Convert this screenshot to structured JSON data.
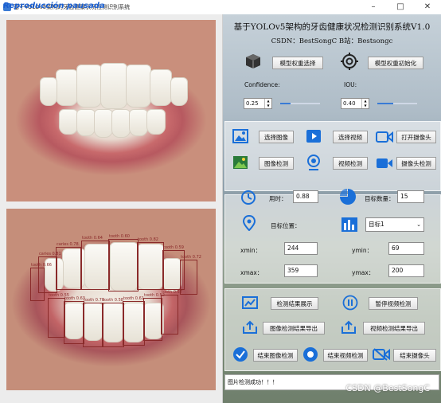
{
  "window": {
    "title": "基于YOLOv5架构的牙齿健康状况检测识别系统",
    "overlay_text": "Reproducción pausada",
    "controls": [
      "–",
      "□",
      "✕"
    ]
  },
  "header": {
    "title": "基于YOLOv5架构的牙齿健康状况检测识别系统V1.0",
    "subtitle": "CSDN：BestSongC   B站：Bestsongc"
  },
  "model": {
    "select_label": "模型权重选择",
    "init_label": "模型权重初始化",
    "confidence_label": "Confidence:",
    "confidence_value": "0.25",
    "confidence_level": 0.25,
    "iou_label": "IOU:",
    "iou_value": "0.40",
    "iou_level": 0.4
  },
  "actions": {
    "select_image": "选择图像",
    "select_video": "选择视频",
    "open_camera": "打开摄像头",
    "image_detect": "图像检测",
    "video_detect": "视频检测",
    "camera_detect": "摄像头检测"
  },
  "results": {
    "time_label": "用时：",
    "time_value": "0.88",
    "count_label": "目标数量：",
    "count_value": "15",
    "position_label": "目标位置：",
    "target_select": "目标1",
    "xmin_label": "xmin：",
    "xmin_value": "244",
    "ymin_label": "ymin：",
    "ymin_value": "69",
    "xmax_label": "xmax：",
    "xmax_value": "359",
    "ymax_label": "ymax：",
    "ymax_value": "200"
  },
  "controls": {
    "show_results": "检测结果展示",
    "pause_video": "暂停视频检测",
    "export_image": "图像检测结果导出",
    "export_video": "视频检测结果导出",
    "end_image": "结束图像检测",
    "end_video": "结束视频检测",
    "end_camera": "结束摄像头"
  },
  "status": {
    "message": "图片检测成功！！！"
  },
  "watermark": "CSDN @BestSongC",
  "detections": [
    {
      "label": "caries 0.81"
    },
    {
      "label": "caries 0.78"
    },
    {
      "label": "tooth 0.64"
    },
    {
      "label": "tooth 0.60"
    },
    {
      "label": "tooth 0.82"
    },
    {
      "label": "tooth 0.59"
    },
    {
      "label": "tooth 0.72"
    },
    {
      "label": "tooth 0.66"
    },
    {
      "label": "tooth 0.55"
    },
    {
      "label": "tooth 0.63"
    },
    {
      "label": "tooth 0.70"
    },
    {
      "label": "tooth 0.58"
    },
    {
      "label": "tooth 0.61"
    },
    {
      "label": "tooth 0.52"
    },
    {
      "label": "tooth 0.57"
    }
  ],
  "colors": {
    "accent": "#3a7bd5",
    "box": "#8a2a2a"
  }
}
